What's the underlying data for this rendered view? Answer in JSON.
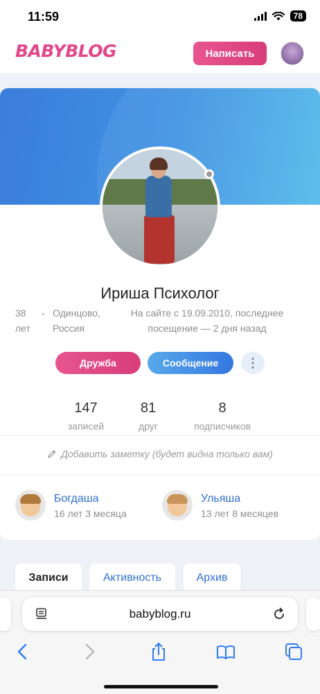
{
  "status_bar": {
    "time": "11:59",
    "battery": "78"
  },
  "header": {
    "logo": "BABYBLOG",
    "write_label": "Написать"
  },
  "profile": {
    "name": "Ириша Психолог",
    "age": "38 лет",
    "city": "Одинцово, Россия",
    "since": "На сайте с 19.09.2010, последнее посещение — 2 дня назад",
    "friend_label": "Дружба",
    "message_label": "Сообщение",
    "more_label": "⋮"
  },
  "stats": [
    {
      "value": "147",
      "label": "записей"
    },
    {
      "value": "81",
      "label": "друг"
    },
    {
      "value": "8",
      "label": "подписчиков"
    }
  ],
  "note": "Добавить заметку (будет видна только вам)",
  "children": [
    {
      "name": "Богдаша",
      "age": "16 лет 3 месяца"
    },
    {
      "name": "Ульяша",
      "age": "13 лет 8 месяцев"
    }
  ],
  "tabs": [
    {
      "label": "Записи",
      "active": true
    },
    {
      "label": "Активность",
      "active": false
    },
    {
      "label": "Архив",
      "active": false
    }
  ],
  "browser": {
    "url": "babyblog.ru"
  },
  "colors": {
    "brand_pink": "#e2478a",
    "link_blue": "#2f6fd0",
    "cover_blue": "#3b7ddb"
  }
}
